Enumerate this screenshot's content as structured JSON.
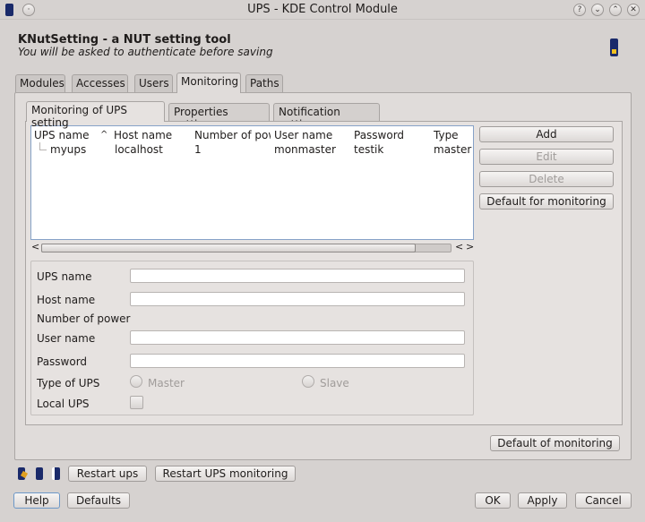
{
  "window": {
    "title": "UPS - KDE Control Module",
    "buttons": [
      "help-icon",
      "minimize-icon",
      "maximize-icon",
      "close-icon"
    ]
  },
  "header": {
    "title": "KNutSetting - a NUT setting tool",
    "subtitle": "You will be asked to authenticate before saving"
  },
  "tabs": [
    {
      "label": "Modules",
      "active": false
    },
    {
      "label": "Accesses",
      "active": false
    },
    {
      "label": "Users",
      "active": false
    },
    {
      "label": "Monitoring",
      "active": true
    },
    {
      "label": "Paths",
      "active": false
    }
  ],
  "subtabs": [
    {
      "label": "Monitoring of UPS setting",
      "active": true
    },
    {
      "label": "Properties setting",
      "active": false
    },
    {
      "label": "Notification setting",
      "active": false
    }
  ],
  "table": {
    "columns": [
      "UPS name",
      "Host name",
      "Number of pow",
      "User name",
      "Password",
      "Type"
    ],
    "sort_indicator": "^",
    "rows": [
      [
        "myups",
        "localhost",
        "1",
        "monmaster",
        "testik",
        "master"
      ]
    ]
  },
  "side_buttons": {
    "add": "Add",
    "edit": "Edit",
    "delete": "Delete",
    "default_monitoring": "Default for monitoring"
  },
  "form": {
    "ups_name": {
      "label": "UPS name",
      "value": ""
    },
    "host_name": {
      "label": "Host name",
      "value": ""
    },
    "number_of_power": {
      "label": "Number of power"
    },
    "user_name": {
      "label": "User name",
      "value": ""
    },
    "password": {
      "label": "Password",
      "value": ""
    },
    "type_of_ups": {
      "label": "Type of UPS",
      "options": [
        "Master",
        "Slave"
      ]
    },
    "local_ups": {
      "label": "Local UPS",
      "checked": false
    }
  },
  "default_of_monitoring": "Default of monitoring",
  "bottom_bar": {
    "restart_ups": "Restart ups",
    "restart_ups_monitoring": "Restart UPS monitoring"
  },
  "dialog_buttons": {
    "help": "Help",
    "defaults": "Defaults",
    "ok": "OK",
    "apply": "Apply",
    "cancel": "Cancel"
  },
  "colors": {
    "background": "#d6d2d0",
    "list_border": "#86a2c8",
    "disabled_text": "#a09c9a"
  }
}
